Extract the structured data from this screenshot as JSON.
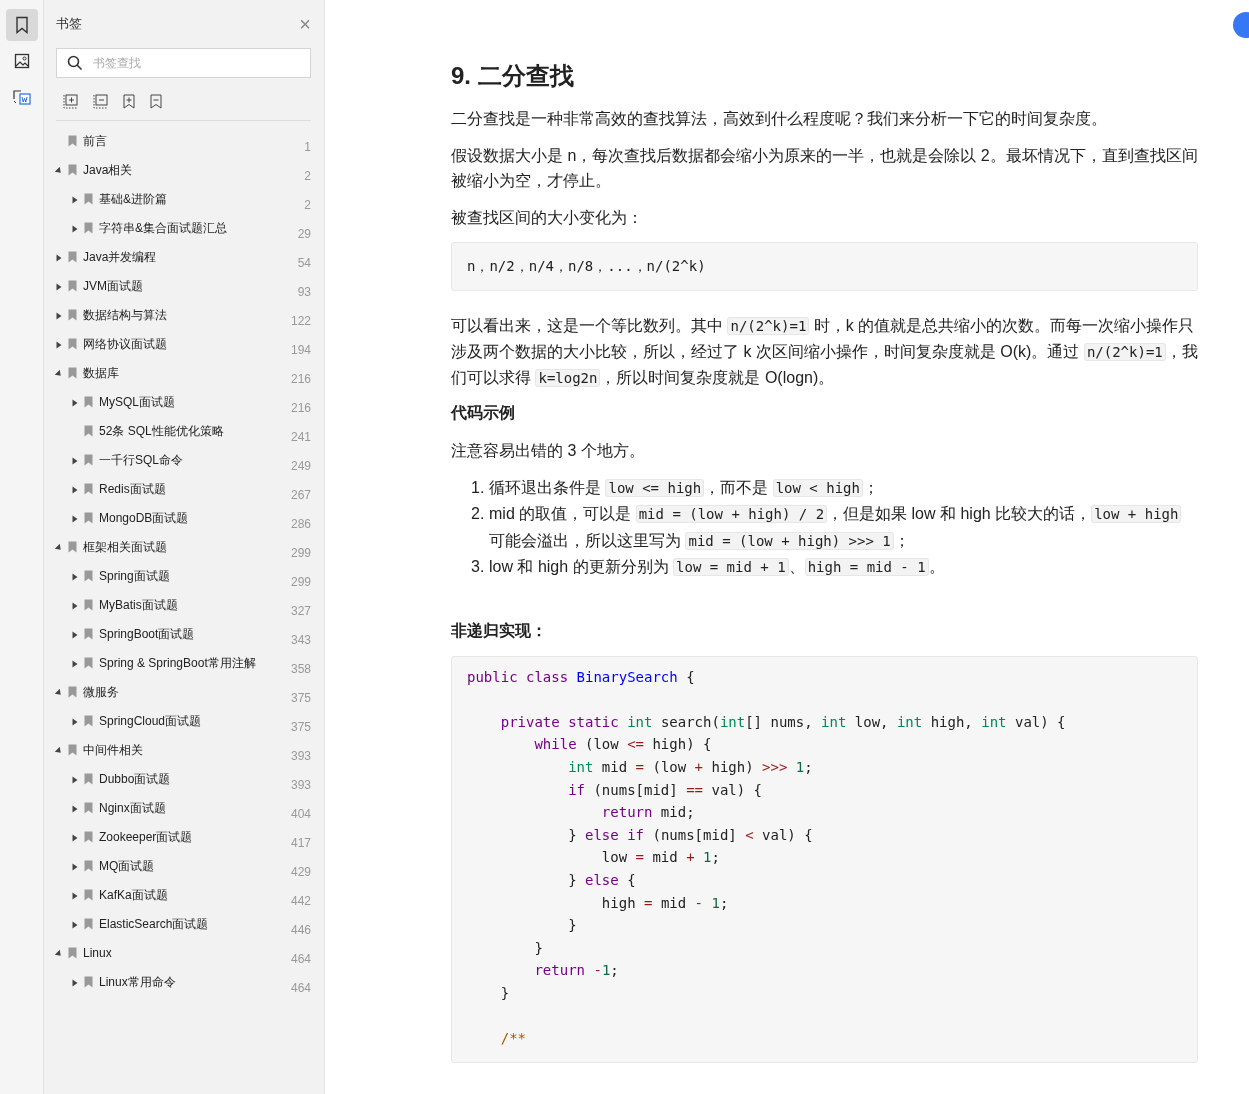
{
  "rail": [
    {
      "selected": true
    },
    {
      "selected": false
    },
    {
      "selected": false
    }
  ],
  "sidebar": {
    "title": "书签",
    "close": "×",
    "search": {
      "placeholder": "书签查找"
    },
    "bookmarks": [
      {
        "label": "前言",
        "page": "1",
        "kind": "leaf"
      },
      {
        "label": "Java相关",
        "page": "2",
        "kind": "folder",
        "expanded": true,
        "children": [
          {
            "label": "基础&进阶篇",
            "page": "2",
            "kind": "folder",
            "expanded": false
          },
          {
            "label": "字符串&集合面试题汇总",
            "page": "29",
            "kind": "folder",
            "expanded": false
          }
        ]
      },
      {
        "label": "Java并发编程",
        "page": "54",
        "kind": "folder",
        "expanded": false
      },
      {
        "label": "JVM面试题",
        "page": "93",
        "kind": "folder",
        "expanded": false
      },
      {
        "label": "数据结构与算法",
        "page": "122",
        "kind": "folder",
        "expanded": false
      },
      {
        "label": "网络协议面试题",
        "page": "194",
        "kind": "folder",
        "expanded": false
      },
      {
        "label": "数据库",
        "page": "216",
        "kind": "folder",
        "expanded": true,
        "children": [
          {
            "label": "MySQL面试题",
            "page": "216",
            "kind": "folder",
            "expanded": false
          },
          {
            "label": "52条 SQL性能优化策略",
            "page": "241",
            "kind": "leaf"
          },
          {
            "label": "一千行SQL命令",
            "page": "249",
            "kind": "folder",
            "expanded": false
          },
          {
            "label": "Redis面试题",
            "page": "267",
            "kind": "folder",
            "expanded": false
          },
          {
            "label": "MongoDB面试题",
            "page": "286",
            "kind": "folder",
            "expanded": false
          }
        ]
      },
      {
        "label": "框架相关面试题",
        "page": "299",
        "kind": "folder",
        "expanded": true,
        "children": [
          {
            "label": "Spring面试题",
            "page": "299",
            "kind": "folder",
            "expanded": false
          },
          {
            "label": "MyBatis面试题",
            "page": "327",
            "kind": "folder",
            "expanded": false
          },
          {
            "label": "SpringBoot面试题",
            "page": "343",
            "kind": "folder",
            "expanded": false
          },
          {
            "label": "Spring & SpringBoot常用注解",
            "page": "358",
            "kind": "folder",
            "expanded": false
          }
        ]
      },
      {
        "label": "微服务",
        "page": "375",
        "kind": "folder",
        "expanded": true,
        "children": [
          {
            "label": "SpringCloud面试题",
            "page": "375",
            "kind": "folder",
            "expanded": false
          }
        ]
      },
      {
        "label": "中间件相关",
        "page": "393",
        "kind": "folder",
        "expanded": true,
        "children": [
          {
            "label": "Dubbo面试题",
            "page": "393",
            "kind": "folder",
            "expanded": false
          },
          {
            "label": "Nginx面试题",
            "page": "404",
            "kind": "folder",
            "expanded": false
          },
          {
            "label": "Zookeeper面试题",
            "page": "417",
            "kind": "folder",
            "expanded": false
          },
          {
            "label": "MQ面试题",
            "page": "429",
            "kind": "folder",
            "expanded": false
          },
          {
            "label": "KafKa面试题",
            "page": "442",
            "kind": "folder",
            "expanded": false
          },
          {
            "label": "ElasticSearch面试题",
            "page": "446",
            "kind": "folder",
            "expanded": false
          }
        ]
      },
      {
        "label": "Linux",
        "page": "464",
        "kind": "folder",
        "expanded": true,
        "children": [
          {
            "label": "Linux常用命令",
            "page": "464",
            "kind": "folder",
            "expanded": false
          }
        ]
      }
    ]
  },
  "document": {
    "blocks": [
      {
        "kind": "heading",
        "text": "9. 二分查找"
      },
      {
        "kind": "paragraph",
        "segments": [
          {
            "kind": "text",
            "text": "二分查找是一种非常高效的查找算法，高效到什么程度呢？我们来分析一下它的时间复杂度。"
          }
        ]
      },
      {
        "kind": "paragraph",
        "segments": [
          {
            "kind": "text",
            "text": "假设数据大小是 n，每次查找后数据都会缩小为原来的一半，也就是会除以 2。最坏情况下，直到查找区间被缩小为空，才停止。"
          }
        ]
      },
      {
        "kind": "paragraph",
        "segments": [
          {
            "kind": "text",
            "text": "被查找区间的大小变化为："
          }
        ]
      },
      {
        "kind": "codeblock",
        "lines": [
          {
            "tokens": [
              {
                "kind": "plain",
                "text": "n，n/2，n/4，n/8，...，n/(2^k)"
              }
            ]
          }
        ]
      },
      {
        "kind": "paragraph",
        "segments": [
          {
            "kind": "text",
            "text": "可以看出来，这是一个等比数列。其中 "
          },
          {
            "kind": "code",
            "text": "n/(2^k)=1"
          },
          {
            "kind": "text",
            "text": " 时，k 的值就是总共缩小的次数。而每一次缩小操作只涉及两个数据的大小比较，所以，经过了 k 次区间缩小操作，时间复杂度就是 O(k)。通过 "
          },
          {
            "kind": "code",
            "text": "n/(2^k)=1"
          },
          {
            "kind": "text",
            "text": "，我们可以求得 "
          },
          {
            "kind": "code",
            "text": "k=log2n"
          },
          {
            "kind": "text",
            "text": "，所以时间复杂度就是 O(logn)。"
          }
        ]
      },
      {
        "kind": "subheading",
        "text": "代码示例"
      },
      {
        "kind": "paragraph",
        "segments": [
          {
            "kind": "text",
            "text": "注意容易出错的 3 个地方。"
          }
        ]
      },
      {
        "kind": "list",
        "items": [
          {
            "marker": "1.",
            "segments": [
              {
                "kind": "text",
                "text": "循环退出条件是 "
              },
              {
                "kind": "code",
                "text": "low <= high"
              },
              {
                "kind": "text",
                "text": "，而不是 "
              },
              {
                "kind": "code",
                "text": "low < high"
              },
              {
                "kind": "text",
                "text": "；"
              }
            ]
          },
          {
            "marker": "2.",
            "segments": [
              {
                "kind": "text",
                "text": "mid 的取值，可以是 "
              },
              {
                "kind": "code",
                "text": "mid = (low + high) / 2"
              },
              {
                "kind": "text",
                "text": "，但是如果 low 和 high 比较大的话，"
              },
              {
                "kind": "code",
                "text": "low + high"
              },
              {
                "kind": "text",
                "text": " 可能会溢出，所以这里写为 "
              },
              {
                "kind": "code",
                "text": "mid = (low + high) >>> 1"
              },
              {
                "kind": "text",
                "text": "；"
              }
            ]
          },
          {
            "marker": "3.",
            "segments": [
              {
                "kind": "text",
                "text": "low 和 high 的更新分别为 "
              },
              {
                "kind": "code",
                "text": "low = mid + 1"
              },
              {
                "kind": "text",
                "text": "、"
              },
              {
                "kind": "code",
                "text": "high = mid - 1"
              },
              {
                "kind": "text",
                "text": "。"
              }
            ]
          }
        ]
      },
      {
        "kind": "subheading",
        "text": "非递归实现："
      },
      {
        "kind": "codeblock",
        "lines": [
          {
            "tokens": [
              {
                "kind": "keyword",
                "text": "public class "
              },
              {
                "kind": "class",
                "text": "BinarySearch"
              },
              {
                "kind": "plain",
                "text": " {"
              }
            ]
          },
          {
            "gap_before": true,
            "tokens": [
              {
                "kind": "keyword",
                "text": "    private static "
              },
              {
                "kind": "type",
                "text": "int"
              },
              {
                "kind": "plain",
                "text": " search("
              },
              {
                "kind": "type",
                "text": "int"
              },
              {
                "kind": "plain",
                "text": "[] nums, "
              },
              {
                "kind": "type",
                "text": "int"
              },
              {
                "kind": "plain",
                "text": " low, "
              },
              {
                "kind": "type",
                "text": "int"
              },
              {
                "kind": "plain",
                "text": " high, "
              },
              {
                "kind": "type",
                "text": "int"
              },
              {
                "kind": "plain",
                "text": " val) {"
              }
            ]
          },
          {
            "tokens": [
              {
                "kind": "keyword",
                "text": "        while"
              },
              {
                "kind": "plain",
                "text": " (low "
              },
              {
                "kind": "op",
                "text": "<="
              },
              {
                "kind": "plain",
                "text": " high) {"
              }
            ]
          },
          {
            "tokens": [
              {
                "kind": "type",
                "text": "            int"
              },
              {
                "kind": "plain",
                "text": " mid "
              },
              {
                "kind": "op",
                "text": "="
              },
              {
                "kind": "plain",
                "text": " (low "
              },
              {
                "kind": "op",
                "text": "+"
              },
              {
                "kind": "plain",
                "text": " high) "
              },
              {
                "kind": "op",
                "text": ">>> "
              },
              {
                "kind": "number",
                "text": "1"
              },
              {
                "kind": "plain",
                "text": ";"
              }
            ]
          },
          {
            "tokens": [
              {
                "kind": "keyword",
                "text": "            if"
              },
              {
                "kind": "plain",
                "text": " (nums[mid] "
              },
              {
                "kind": "op",
                "text": "=="
              },
              {
                "kind": "plain",
                "text": " val) {"
              }
            ]
          },
          {
            "tokens": [
              {
                "kind": "keyword",
                "text": "                return"
              },
              {
                "kind": "plain",
                "text": " mid;"
              }
            ]
          },
          {
            "tokens": [
              {
                "kind": "plain",
                "text": "            } "
              },
              {
                "kind": "keyword",
                "text": "else if"
              },
              {
                "kind": "plain",
                "text": " (nums[mid] "
              },
              {
                "kind": "op",
                "text": "<"
              },
              {
                "kind": "plain",
                "text": " val) {"
              }
            ]
          },
          {
            "tokens": [
              {
                "kind": "plain",
                "text": "                low "
              },
              {
                "kind": "op",
                "text": "="
              },
              {
                "kind": "plain",
                "text": " mid "
              },
              {
                "kind": "op",
                "text": "+ "
              },
              {
                "kind": "number",
                "text": "1"
              },
              {
                "kind": "plain",
                "text": ";"
              }
            ]
          },
          {
            "tokens": [
              {
                "kind": "plain",
                "text": "            } "
              },
              {
                "kind": "keyword",
                "text": "else"
              },
              {
                "kind": "plain",
                "text": " {"
              }
            ]
          },
          {
            "tokens": [
              {
                "kind": "plain",
                "text": "                high "
              },
              {
                "kind": "op",
                "text": "="
              },
              {
                "kind": "plain",
                "text": " mid "
              },
              {
                "kind": "op",
                "text": "- "
              },
              {
                "kind": "number",
                "text": "1"
              },
              {
                "kind": "plain",
                "text": ";"
              }
            ]
          },
          {
            "tokens": [
              {
                "kind": "plain",
                "text": "            }"
              }
            ]
          },
          {
            "tokens": [
              {
                "kind": "plain",
                "text": "        }"
              }
            ]
          },
          {
            "tokens": [
              {
                "kind": "keyword",
                "text": "        return"
              },
              {
                "kind": "op",
                "text": " -"
              },
              {
                "kind": "number",
                "text": "1"
              },
              {
                "kind": "plain",
                "text": ";"
              }
            ]
          },
          {
            "tokens": [
              {
                "kind": "plain",
                "text": "    }"
              }
            ]
          },
          {
            "gap_before": true,
            "tokens": [
              {
                "kind": "comment",
                "text": "    /**"
              }
            ]
          }
        ]
      }
    ]
  }
}
